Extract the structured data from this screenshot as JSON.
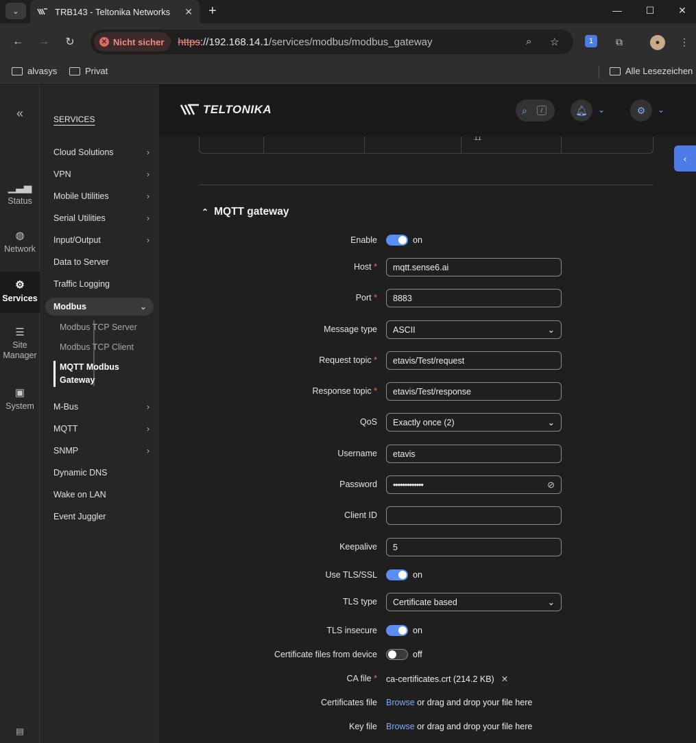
{
  "browser": {
    "tab_title": "TRB143 - Teltonika Networks",
    "tab_close": "✕",
    "new_tab": "+",
    "security_label": "Nicht sicher",
    "url_scheme": "https",
    "url_rest_host": "://192.168.14.1",
    "url_path": "/services/modbus/modbus_gateway",
    "bookmarks": [
      "alvasys",
      "Privat"
    ],
    "all_bookmarks": "Alle Lesezeichen"
  },
  "rail": {
    "collapse": "«",
    "items": [
      {
        "label": "Status",
        "icon": "signal-icon"
      },
      {
        "label": "Network",
        "icon": "globe-icon"
      },
      {
        "label": "Services",
        "icon": "gear-icon"
      },
      {
        "label": "Site Manager",
        "icon": "server-icon"
      },
      {
        "label": "System",
        "icon": "system-icon"
      }
    ]
  },
  "menu": {
    "heading": "SERVICES",
    "items": [
      {
        "label": "Cloud Solutions"
      },
      {
        "label": "VPN"
      },
      {
        "label": "Mobile Utilities"
      },
      {
        "label": "Serial Utilities"
      },
      {
        "label": "Input/Output"
      },
      {
        "label": "Data to Server"
      },
      {
        "label": "Traffic Logging"
      },
      {
        "label": "Modbus"
      },
      {
        "label": "M-Bus"
      },
      {
        "label": "MQTT"
      },
      {
        "label": "SNMP"
      },
      {
        "label": "Dynamic DNS"
      },
      {
        "label": "Wake on LAN"
      },
      {
        "label": "Event Juggler"
      }
    ],
    "modbus_sub": [
      "Modbus TCP Server",
      "Modbus TCP Client",
      "MQTT Modbus Gateway"
    ]
  },
  "header": {
    "logo_text": "TELTONIKA",
    "search_key": "/"
  },
  "table_fragment": {
    "cell_value": "11"
  },
  "section": {
    "title": "MQTT gateway",
    "fields": {
      "enable": {
        "label": "Enable",
        "state": "on"
      },
      "host": {
        "label": "Host",
        "value": "mqtt.sense6.ai"
      },
      "port": {
        "label": "Port",
        "value": "8883"
      },
      "message_type": {
        "label": "Message type",
        "value": "ASCII"
      },
      "request_topic": {
        "label": "Request topic",
        "value": "etavis/Test/request"
      },
      "response_topic": {
        "label": "Response topic",
        "value": "etavis/Test/response"
      },
      "qos": {
        "label": "QoS",
        "value": "Exactly once (2)"
      },
      "username": {
        "label": "Username",
        "value": "etavis"
      },
      "password": {
        "label": "Password",
        "value": "•••••••••••••"
      },
      "client_id": {
        "label": "Client ID",
        "value": ""
      },
      "keepalive": {
        "label": "Keepalive",
        "value": "5"
      },
      "use_tls": {
        "label": "Use TLS/SSL",
        "state": "on"
      },
      "tls_type": {
        "label": "TLS type",
        "value": "Certificate based"
      },
      "tls_insecure": {
        "label": "TLS insecure",
        "state": "on"
      },
      "cert_from_device": {
        "label": "Certificate files from device",
        "state": "off"
      },
      "ca_file": {
        "label": "CA file",
        "filename": "ca-certificates.crt",
        "size": "(214.2 KB)"
      },
      "cert_file": {
        "label": "Certificates file",
        "browse": "Browse",
        "hint": "or drag and drop your file here"
      },
      "key_file": {
        "label": "Key file",
        "browse": "Browse",
        "hint": "or drag and drop your file here"
      }
    },
    "required_mark": "*"
  },
  "colors": {
    "accent": "#5b8ef5",
    "link": "#7fa7f7",
    "required": "#f06a6a",
    "insecure": "#f28b82"
  }
}
